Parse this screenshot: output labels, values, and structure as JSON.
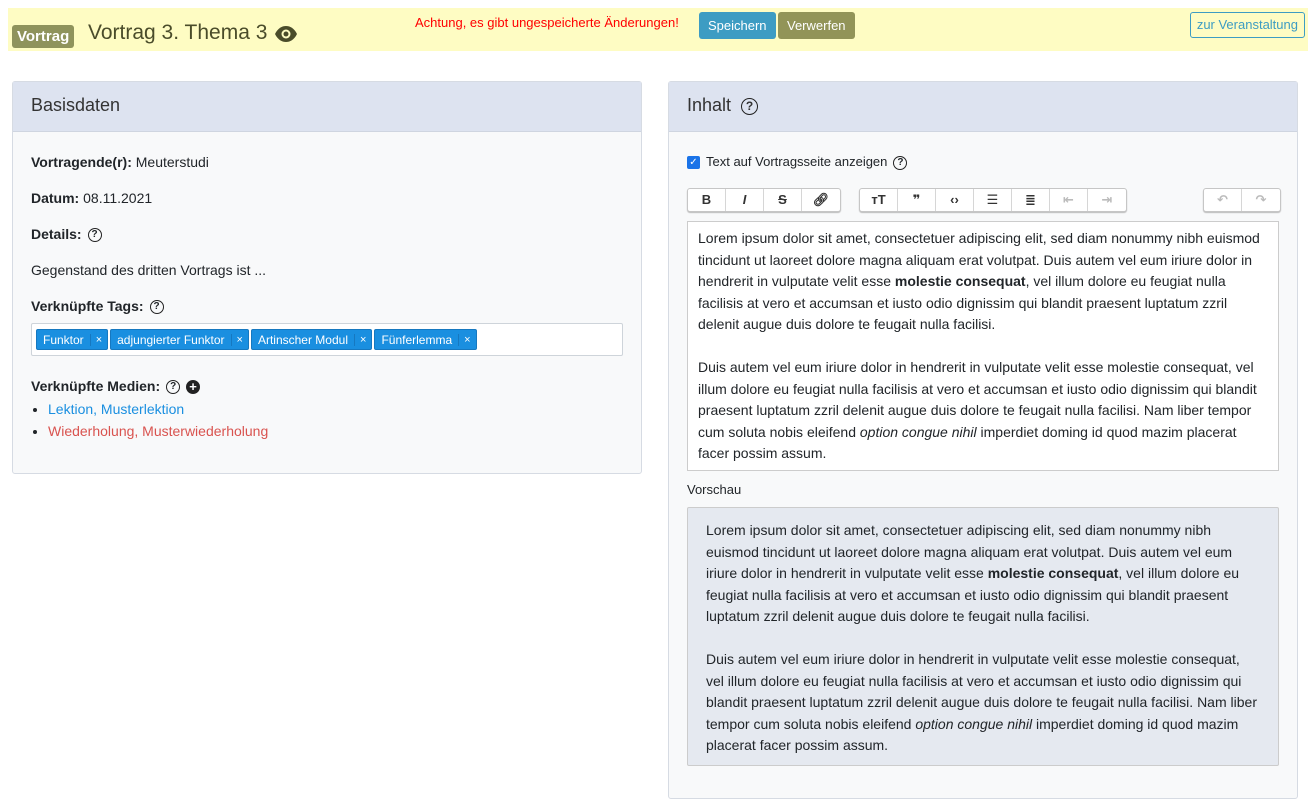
{
  "header": {
    "badge": "Vortrag",
    "title": "Vortrag 3. Thema 3",
    "warning": "Achtung, es gibt ungespeicherte Änderungen!",
    "save": "Speichern",
    "discard": "Verwerfen",
    "to_event": "zur Veranstaltung"
  },
  "basis": {
    "title": "Basisdaten",
    "speaker_label": "Vortragende(r):",
    "speaker": "Meuterstudi",
    "date_label": "Datum:",
    "date": "08.11.2021",
    "details_label": "Details:",
    "details": "Gegenstand des dritten Vortrags ist ...",
    "tags_label": "Verknüpfte Tags:",
    "tags": [
      "Funktor",
      "adjungierter Funktor",
      "Artinscher Modul",
      "Fünferlemma"
    ],
    "media_label": "Verknüpfte Medien:",
    "media": [
      {
        "label": "Lektion, Musterlektion",
        "color": "#1a8fe0"
      },
      {
        "label": "Wiederholung, Musterwiederholung",
        "color": "#d9534f"
      }
    ]
  },
  "content": {
    "title": "Inhalt",
    "show_text_label": "Text auf Vortragsseite anzeigen",
    "show_text": true,
    "toolbar": [
      "bold",
      "italic",
      "strikethrough",
      "link",
      "heading",
      "quote",
      "code",
      "bullet-list",
      "numbered-list",
      "outdent",
      "indent",
      "undo",
      "redo"
    ],
    "p1": {
      "a": "Lorem ipsum dolor sit amet, consectetuer adipiscing elit, sed diam nonummy nibh euismod tincidunt ut laoreet dolore magna aliquam erat volutpat. Duis autem vel eum iriure dolor in hendrerit in vulputate velit esse ",
      "b": "molestie consequat",
      "c": ", vel illum dolore eu feugiat nulla facilisis at vero et accumsan et iusto odio dignissim qui blandit praesent luptatum zzril delenit augue duis dolore te feugait nulla facilisi."
    },
    "p2": {
      "a": "Duis autem vel eum iriure dolor in hendrerit in vulputate velit esse molestie consequat, vel illum dolore eu feugiat nulla facilisis at vero et accumsan et iusto odio dignissim qui blandit praesent luptatum zzril delenit augue duis dolore te feugait nulla facilisi. Nam liber tempor cum soluta nobis eleifend ",
      "i": "option congue nihil",
      "c": " imperdiet doming id quod mazim placerat facer possim assum."
    },
    "preview_label": "Vorschau"
  }
}
